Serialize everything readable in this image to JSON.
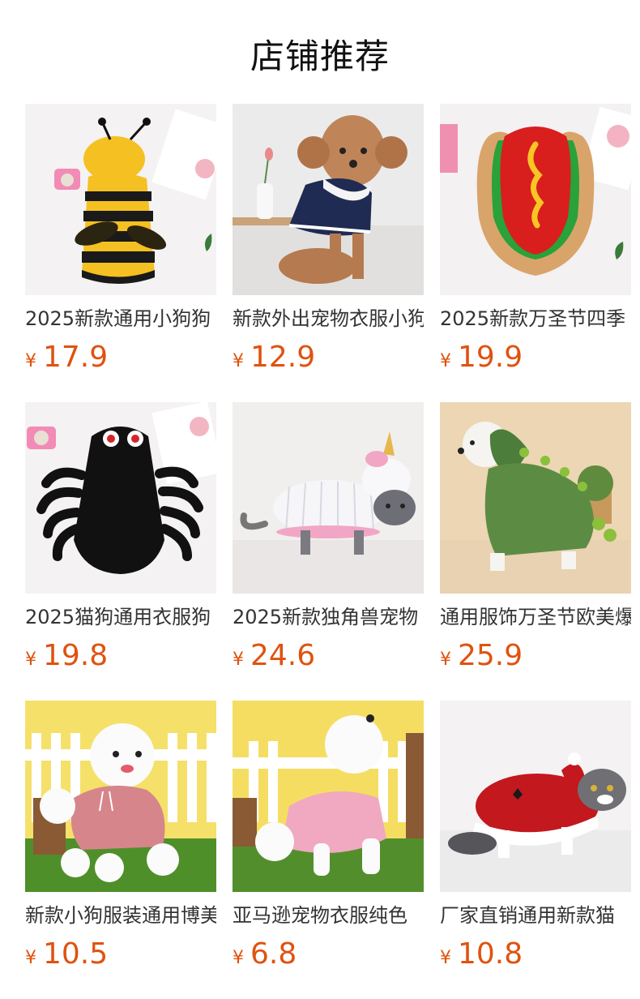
{
  "header": {
    "title": "店铺推荐"
  },
  "currency": "¥",
  "products": [
    {
      "name": "2025新款通用小狗狗",
      "price": "17.9",
      "image": "bee-costume"
    },
    {
      "name": "新款外出宠物衣服小狗",
      "price": "12.9",
      "image": "poodle-sailor-sweater"
    },
    {
      "name": "2025新款万圣节四季",
      "price": "19.9",
      "image": "hotdog-costume"
    },
    {
      "name": "2025猫狗通用衣服狗",
      "price": "19.8",
      "image": "spider-costume"
    },
    {
      "name": "2025新款独角兽宠物",
      "price": "24.6",
      "image": "unicorn-cat-costume"
    },
    {
      "name": "通用服饰万圣节欧美爆",
      "price": "25.9",
      "image": "dinosaur-dog-costume"
    },
    {
      "name": "新款小狗服装通用博美",
      "price": "10.5",
      "image": "pink-hoodie-poodle"
    },
    {
      "name": "亚马逊宠物衣服纯色",
      "price": "6.8",
      "image": "pink-dress-poodle"
    },
    {
      "name": "厂家直销通用新款猫",
      "price": "10.8",
      "image": "red-santa-cat"
    }
  ]
}
